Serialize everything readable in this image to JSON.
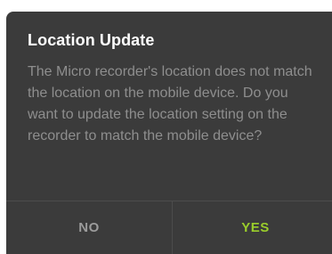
{
  "dialog": {
    "title": "Location Update",
    "message": "The Micro recorder's location does not match the location on the mobile device. Do you want to update the location setting on the recorder to match the mobile device?",
    "buttons": {
      "no_label": "NO",
      "yes_label": "YES"
    },
    "colors": {
      "background": "#3b3b3b",
      "title": "#ffffff",
      "message": "#8e8e8e",
      "no": "#9b9b9b",
      "yes_accent": "#9acd2b"
    }
  }
}
